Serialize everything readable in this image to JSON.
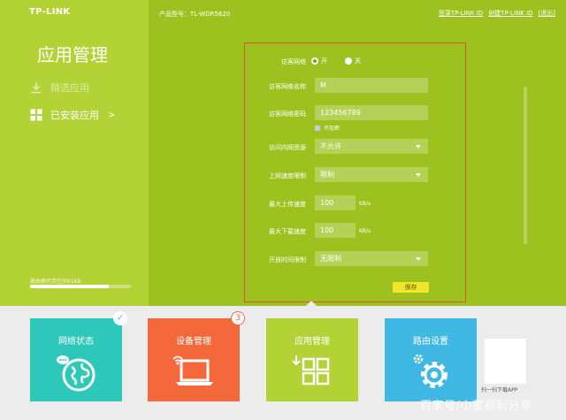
{
  "header": {
    "brand": "TP-LINK",
    "model_label": "产品型号：TL-WDR5620",
    "links": [
      "登录TP-LINK ID",
      "创建TP-LINK ID",
      "[退出]"
    ]
  },
  "sidebar": {
    "title": "应用管理",
    "items": [
      {
        "label": "精选应用",
        "icon": "download-icon"
      },
      {
        "label": "已安装应用",
        "icon": "grid-icon",
        "chevron": ">"
      }
    ],
    "storage_text": "路由器可用空间91KB",
    "storage_used_fraction": 0.78
  },
  "form": {
    "guest_network": {
      "label": "访客网络",
      "options": [
        "开",
        "关"
      ],
      "selected": "开"
    },
    "ssid": {
      "label": "访客网络名称",
      "value": "M"
    },
    "password": {
      "label": "访客网络密码",
      "value": "123456789"
    },
    "no_encrypt": {
      "label": "不加密",
      "checked": false
    },
    "intranet_access": {
      "label": "访问内网资源",
      "value": "不允许"
    },
    "speed_limit": {
      "label": "上网速度限制",
      "value": "限制"
    },
    "max_upload": {
      "label": "最大上传速度",
      "value": "100",
      "unit": "KB/s"
    },
    "max_download": {
      "label": "最大下载速度",
      "value": "100",
      "unit": "KB/s"
    },
    "open_time": {
      "label": "开放时间限制",
      "value": "无限制"
    },
    "save_label": "保存"
  },
  "tiles": [
    {
      "label": "网络状态",
      "color": "#2dc8b9",
      "icon": "globe-icon",
      "badge": "✓"
    },
    {
      "label": "设备管理",
      "color": "#f4693c",
      "icon": "laptop-icon",
      "badge": "3"
    },
    {
      "label": "应用管理",
      "color": "#b3d236",
      "icon": "apps-icon"
    },
    {
      "label": "路由设置",
      "color": "#3fb9e3",
      "icon": "gear-icon"
    }
  ],
  "qr": {
    "caption": "扫一扫下载APP"
  },
  "watermark": "百家号/小蒙福利分享",
  "colors": {
    "accent": "#9dc21f",
    "sidebar": "#b3d236",
    "save": "#f2e32b",
    "frame": "#d9572c"
  }
}
